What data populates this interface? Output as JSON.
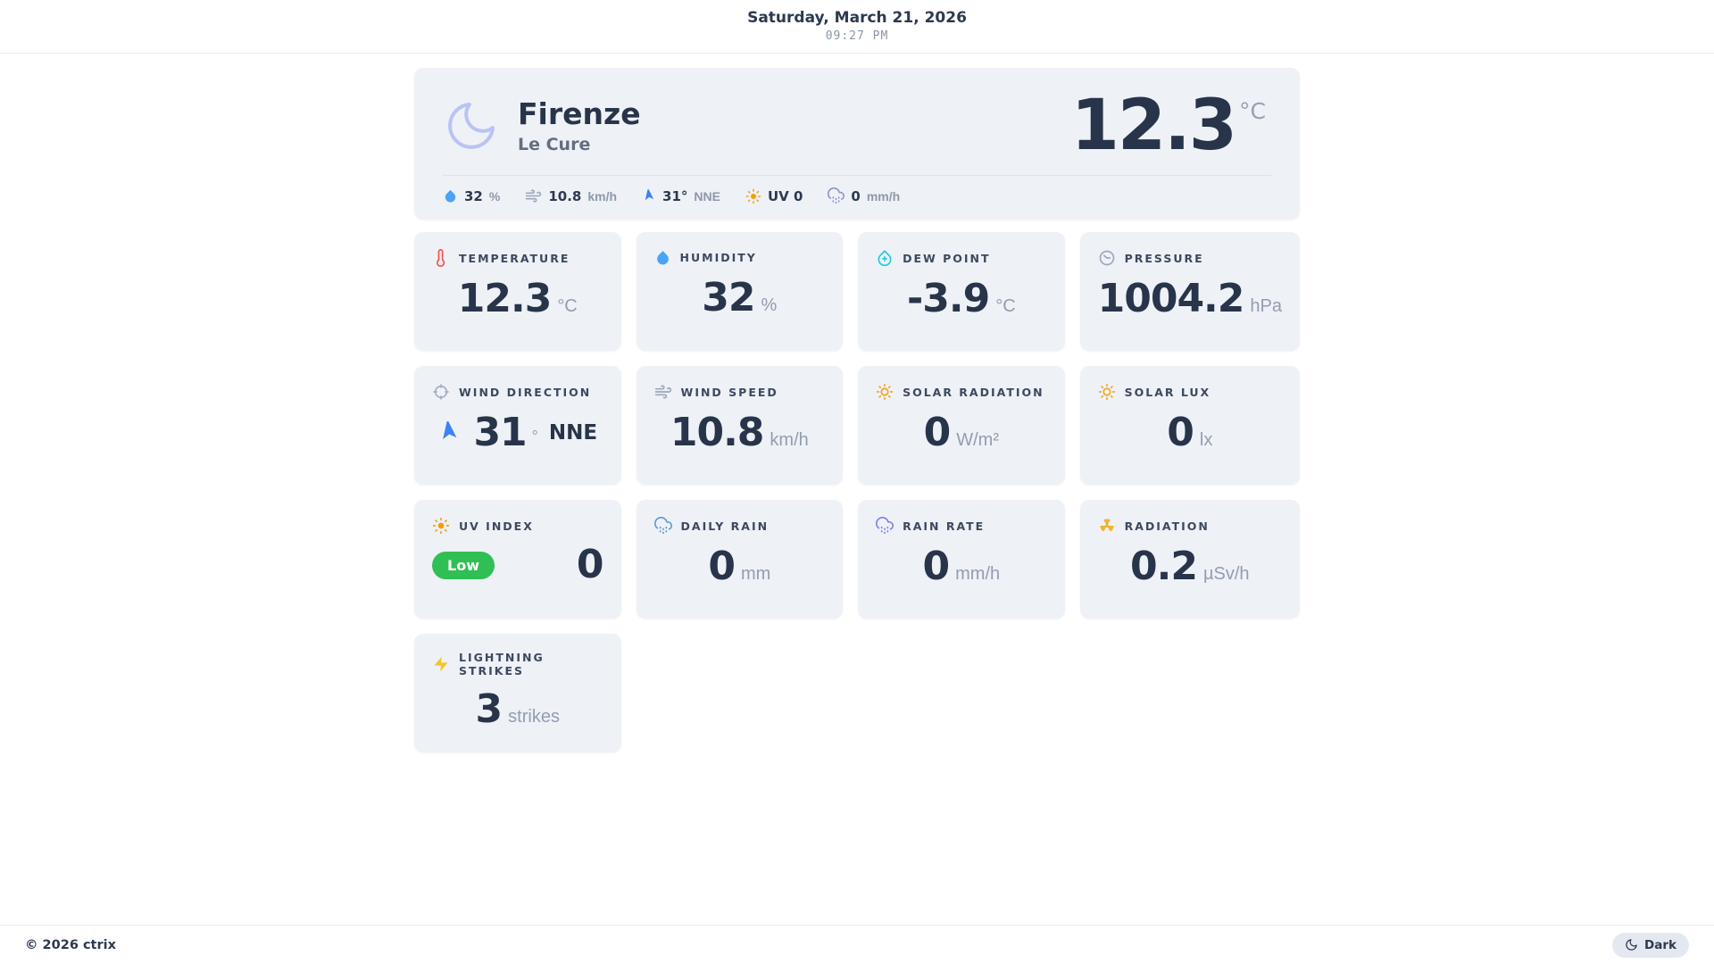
{
  "header": {
    "date": "Saturday, March 21, 2026",
    "time": "09:27 PM"
  },
  "hero": {
    "city": "Firenze",
    "district": "Le Cure",
    "temperature": "12.3",
    "temperature_unit": "°C",
    "condition_icon": "moon-icon",
    "stats": [
      {
        "icon": "droplet-icon",
        "value": "32",
        "unit": "%"
      },
      {
        "icon": "wind-icon",
        "value": "10.8",
        "unit": "km/h"
      },
      {
        "icon": "navigation-icon",
        "value": "31°",
        "unit": "NNE"
      },
      {
        "icon": "sun-icon",
        "value": "UV 0",
        "unit": ""
      },
      {
        "icon": "cloud-rain-icon",
        "value": "0",
        "unit": "mm/h"
      }
    ]
  },
  "cards": [
    {
      "id": "temperature",
      "icon": "thermometer-icon",
      "label": "TEMPERATURE",
      "value": "12.3",
      "unit": "°C"
    },
    {
      "id": "humidity",
      "icon": "droplet-icon",
      "label": "HUMIDITY",
      "value": "32",
      "unit": "%"
    },
    {
      "id": "dew-point",
      "icon": "droplet-plus-icon",
      "label": "DEW POINT",
      "value": "-3.9",
      "unit": "°C"
    },
    {
      "id": "pressure",
      "icon": "gauge-icon",
      "label": "PRESSURE",
      "value": "1004.2",
      "unit": "hPa"
    },
    {
      "id": "wind-direction",
      "icon": "compass-icon",
      "label": "WIND DIRECTION",
      "value": "31",
      "unit": "°",
      "extra": "NNE"
    },
    {
      "id": "wind-speed",
      "icon": "wind-icon",
      "label": "WIND SPEED",
      "value": "10.8",
      "unit": "km/h"
    },
    {
      "id": "solar-radiation",
      "icon": "sun-icon",
      "label": "SOLAR RADIATION",
      "value": "0",
      "unit": "W/m²"
    },
    {
      "id": "solar-lux",
      "icon": "sun-icon",
      "label": "SOLAR LUX",
      "value": "0",
      "unit": "lx"
    },
    {
      "id": "uv-index",
      "icon": "sun-icon",
      "label": "UV INDEX",
      "badge": "Low",
      "value": "0",
      "unit": ""
    },
    {
      "id": "daily-rain",
      "icon": "cloud-rain-icon",
      "label": "DAILY RAIN",
      "value": "0",
      "unit": "mm"
    },
    {
      "id": "rain-rate",
      "icon": "cloud-rain-icon",
      "label": "RAIN RATE",
      "value": "0",
      "unit": "mm/h"
    },
    {
      "id": "radiation",
      "icon": "radiation-icon",
      "label": "RADIATION",
      "value": "0.2",
      "unit": "µSv/h"
    },
    {
      "id": "lightning-strikes",
      "icon": "lightning-icon",
      "label": "LIGHTNING STRIKES",
      "value": "3",
      "unit": "strikes"
    }
  ],
  "footer": {
    "copyright": "© 2026 ctrix",
    "theme_toggle_label": "Dark"
  },
  "colors": {
    "card_background": "#eef1f6",
    "text_primary": "#28344a",
    "text_secondary": "#939db0",
    "moon": "#b9c3f4",
    "droplet_blue": "#4aa3f7",
    "dew_cyan": "#22c8e6",
    "thermometer_red": "#ef5350",
    "sun_orange": "#f59e0b",
    "rain_blue": "#5e9cd3",
    "rain_purple": "#7d82ee",
    "radiation_yellow": "#f0b42e",
    "lightning_yellow": "#f7c325",
    "uv_badge_green": "#2fbf55",
    "nav_arrow_blue": "#3b82f6"
  }
}
